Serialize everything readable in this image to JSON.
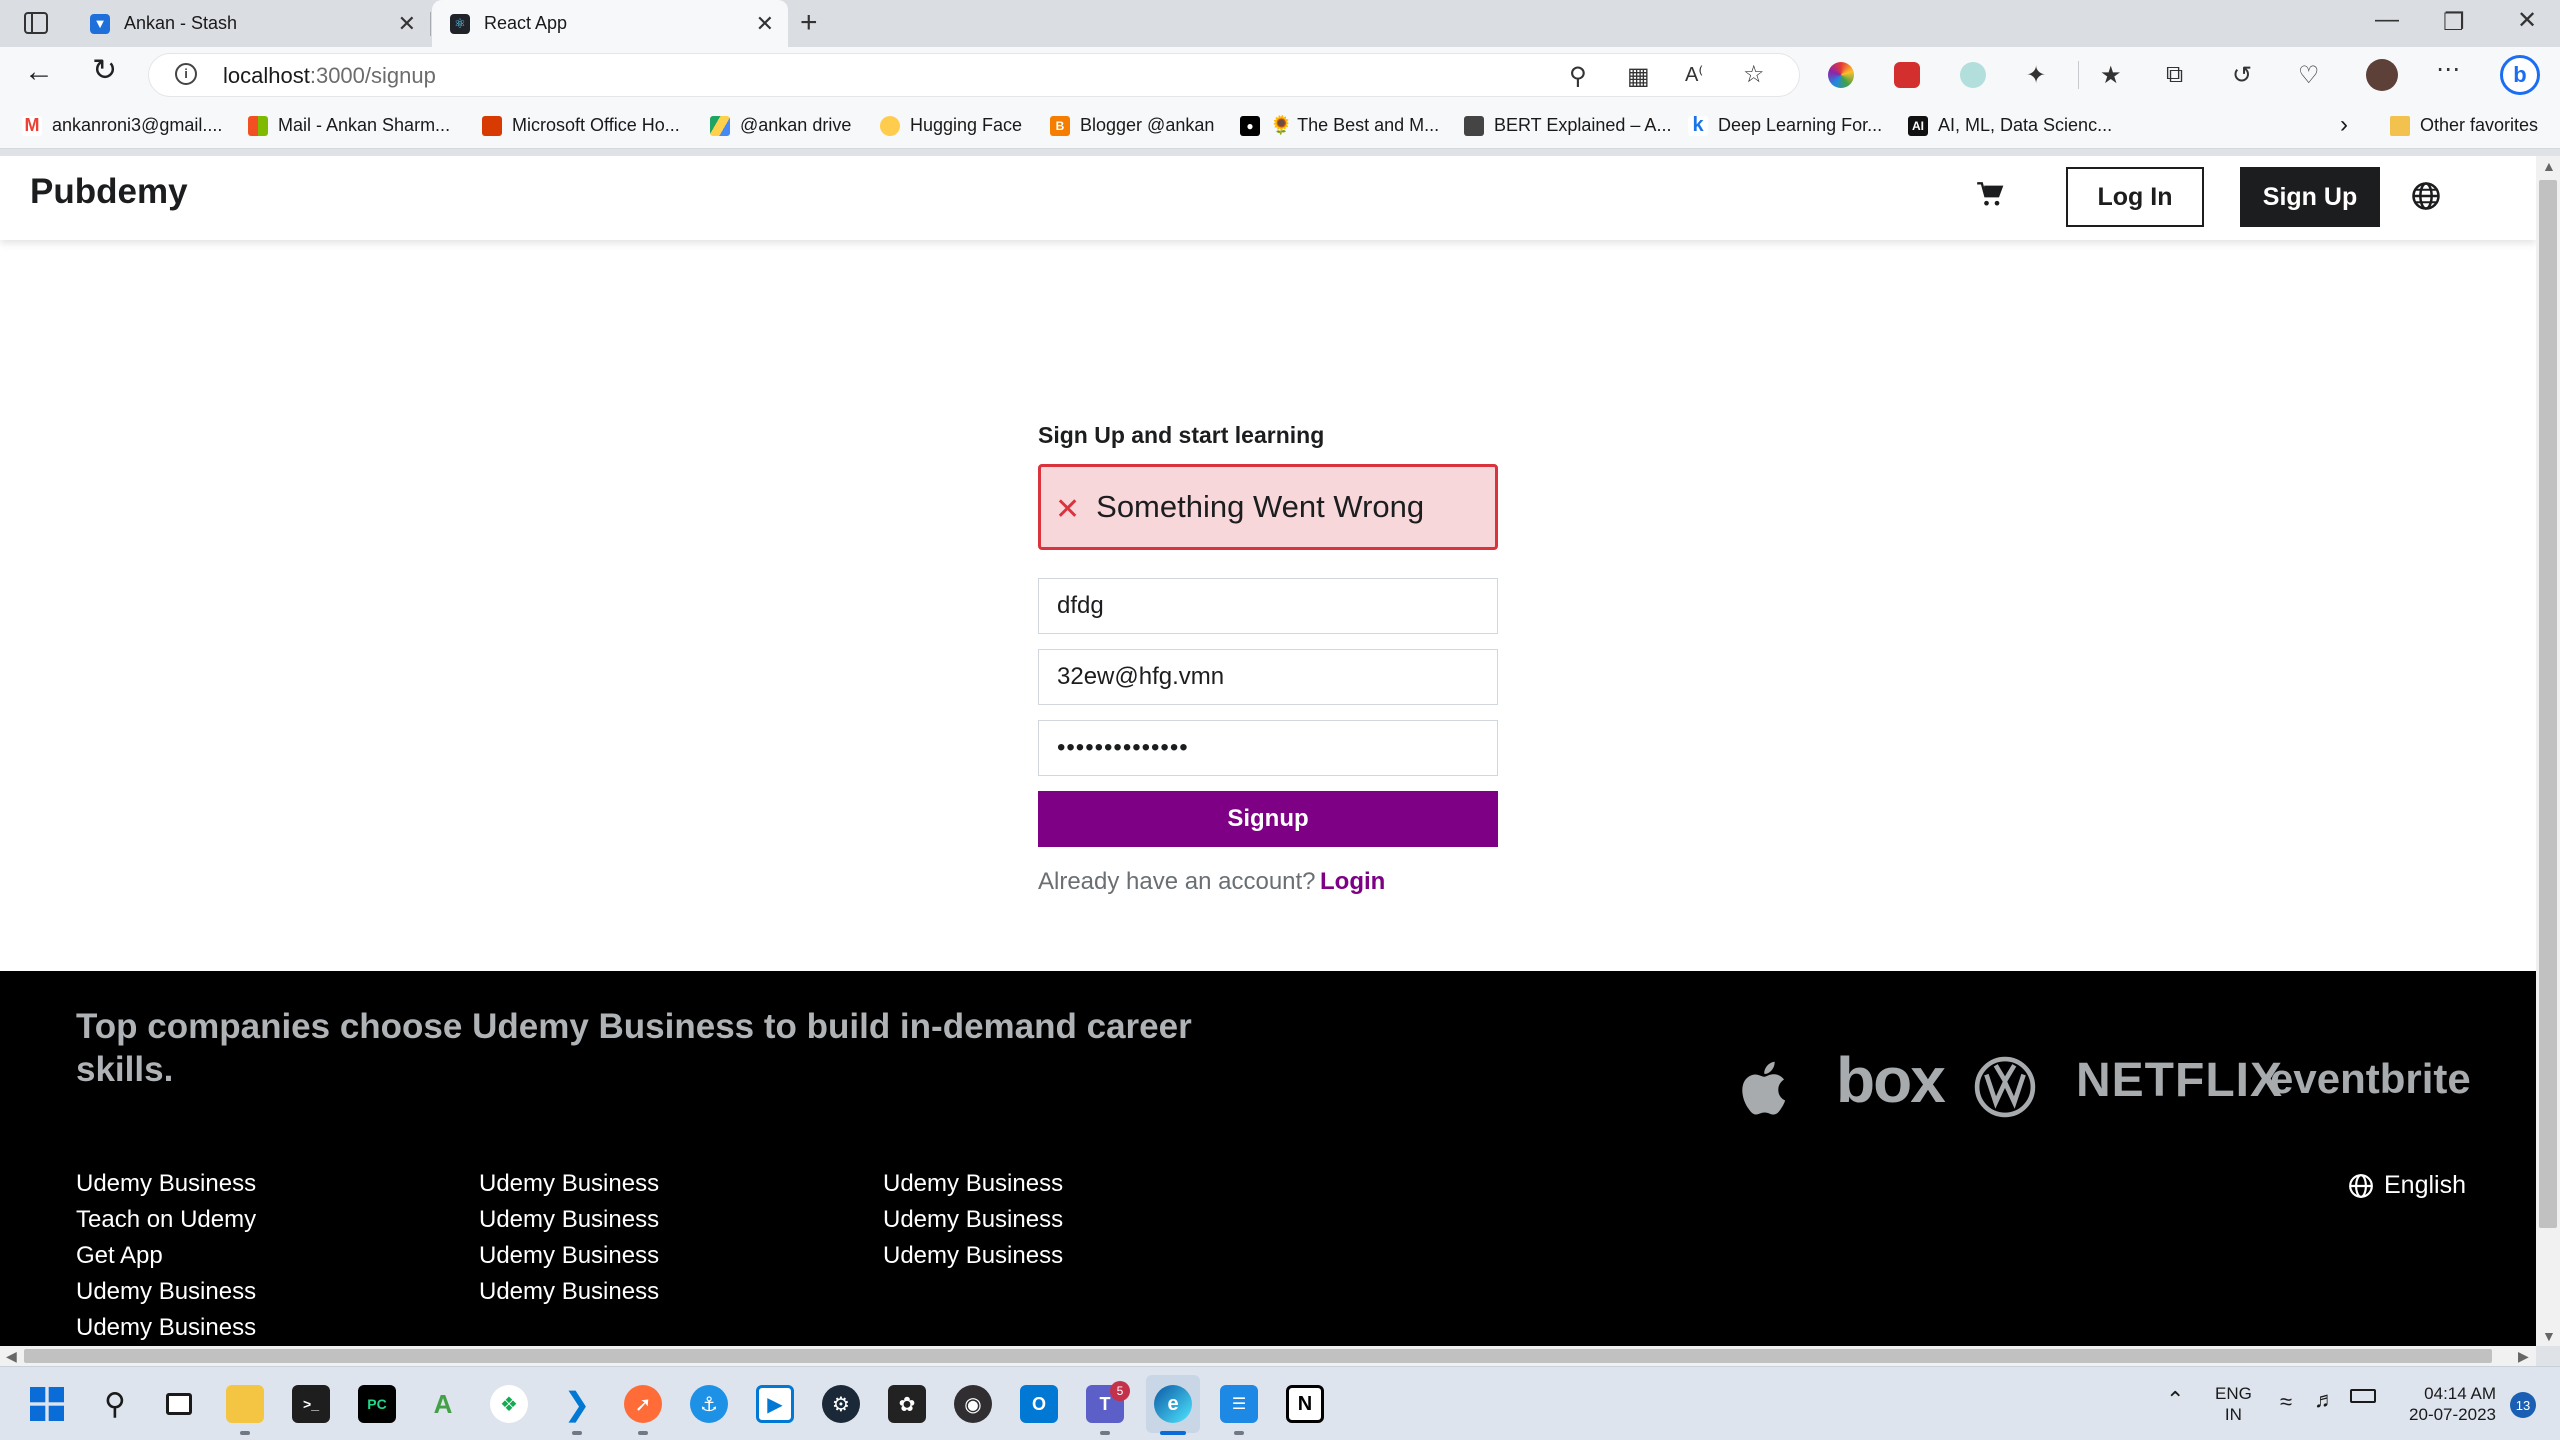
{
  "browser": {
    "tabs": [
      {
        "title": "Ankan - Stash",
        "icon": "stash-icon"
      },
      {
        "title": "React App",
        "icon": "react-icon"
      }
    ],
    "url_host": "localhost",
    "url_path": ":3000/signup",
    "bookmarks": [
      {
        "label": "ankanroni3@gmail....",
        "icon": "gmail-icon",
        "color": "#ea4335"
      },
      {
        "label": "Mail - Ankan Sharm...",
        "icon": "microsoft-icon",
        "color": "#f25022"
      },
      {
        "label": "Microsoft Office Ho...",
        "icon": "office-icon",
        "color": "#d83b01"
      },
      {
        "label": "@ankan drive",
        "icon": "drive-icon",
        "color": "#1fa463"
      },
      {
        "label": "Hugging Face",
        "icon": "hugging-face-icon",
        "color": "#ffcc4d"
      },
      {
        "label": "Blogger @ankan",
        "icon": "blogger-icon",
        "color": "#f57d00"
      },
      {
        "label": "🌻 The Best and M...",
        "icon": "medium-icon",
        "color": "#000000"
      },
      {
        "label": "BERT Explained – A...",
        "icon": "bert-icon",
        "color": "#333333"
      },
      {
        "label": "Deep Learning For...",
        "icon": "k-icon",
        "color": "#1a73e8"
      },
      {
        "label": "AI, ML, Data Scienc...",
        "icon": "ai-icon",
        "color": "#111111"
      }
    ],
    "other_favorites": "Other favorites"
  },
  "site": {
    "brand": "Pubdemy",
    "login_label": "Log In",
    "signup_label": "Sign Up"
  },
  "form": {
    "title": "Sign Up and start learning",
    "error": "Something Went Wrong",
    "name_value": "dfdg",
    "email_value": "32ew@hfg.vmn",
    "password_value": "••••••••••••••",
    "submit_label": "Signup",
    "already_text": "Already have an account?",
    "login_link": "Login"
  },
  "footer": {
    "heading": "Top companies choose Udemy Business to build in-demand career skills.",
    "logos": [
      "apple-logo",
      "box",
      "vw-logo",
      "NETFLIX",
      "eventbrite"
    ],
    "col1": [
      "Udemy Business",
      "Teach on Udemy",
      "Get App",
      "Udemy Business",
      "Udemy Business"
    ],
    "col2": [
      "Udemy Business",
      "Udemy Business",
      "Udemy Business",
      "Udemy Business"
    ],
    "col3": [
      "Udemy Business",
      "Udemy Business",
      "Udemy Business"
    ],
    "language": "English"
  },
  "taskbar": {
    "lang_line1": "ENG",
    "lang_line2": "IN",
    "time": "04:14 AM",
    "date": "20-07-2023",
    "notifications": "13",
    "teams_badge": "5"
  },
  "colors": {
    "accent_purple": "#7d0085",
    "error_bg": "#f8d7da",
    "error_border": "#d9343e",
    "footer_bg": "#000000"
  }
}
